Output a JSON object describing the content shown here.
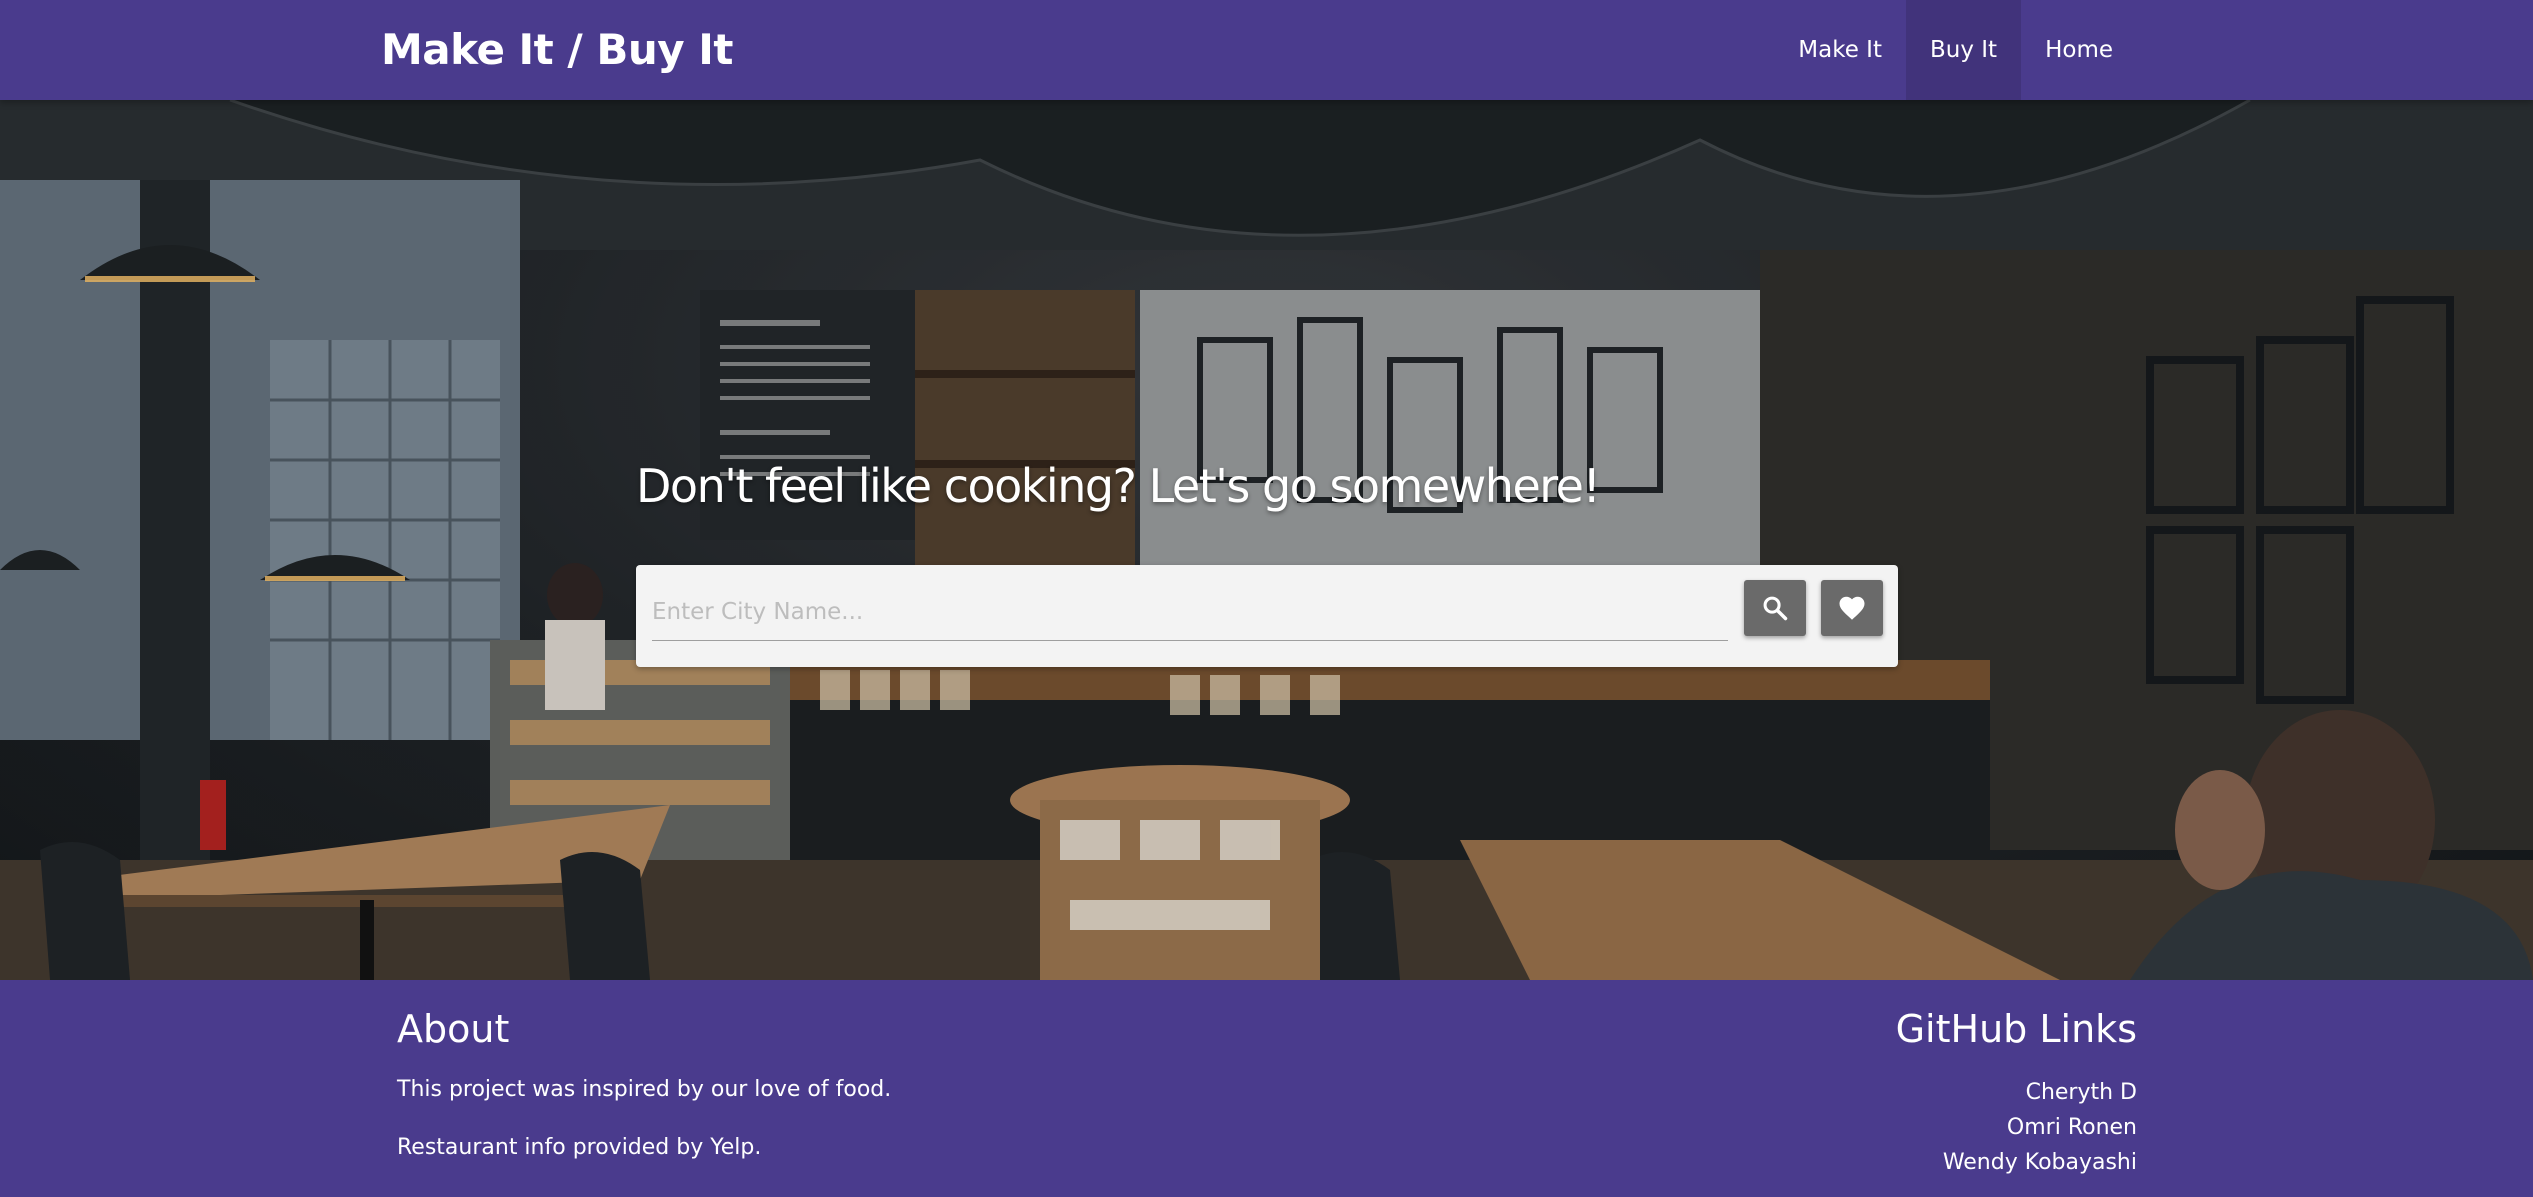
{
  "nav": {
    "brand": "Make It / Buy It",
    "links": [
      {
        "label": "Make It",
        "active": false
      },
      {
        "label": "Buy It",
        "active": true
      },
      {
        "label": "Home",
        "active": false
      }
    ]
  },
  "hero": {
    "heading": "Don't feel like cooking? Let's go somewhere!",
    "search": {
      "placeholder": "Enter City Name...",
      "value": ""
    },
    "search_button_icon": "search-icon",
    "favorites_button_icon": "heart-icon"
  },
  "footer": {
    "about": {
      "title": "About",
      "lines": [
        "This project was inspired by our love of food.",
        "Restaurant info provided by Yelp."
      ]
    },
    "github": {
      "title": "GitHub Links",
      "links": [
        "Cheryth D",
        "Omri Ronen",
        "Wendy Kobayashi"
      ]
    }
  },
  "colors": {
    "primary": "#4a3b8d",
    "card": "#f3f3f3",
    "button": "#6a6a6a"
  }
}
